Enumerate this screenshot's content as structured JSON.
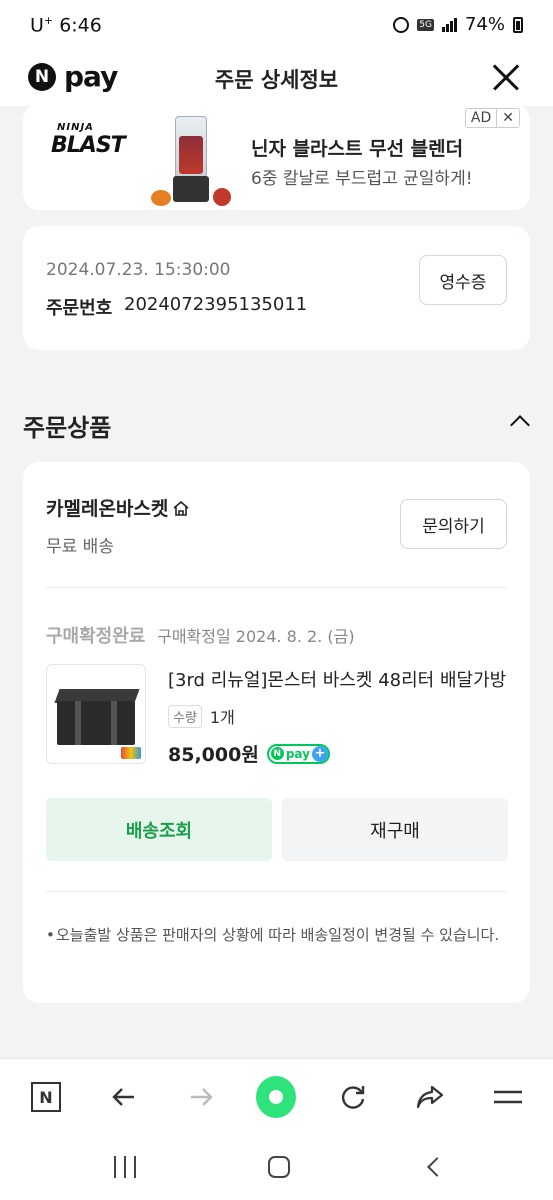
{
  "status_bar": {
    "carrier": "U",
    "carrier_sup": "+",
    "time": "6:46",
    "network": "5G",
    "battery": "74%"
  },
  "header": {
    "logo_letter": "N",
    "logo_text": "pay",
    "title": "주문 상세정보"
  },
  "ad": {
    "brand_small": "NINJA",
    "brand_big": "BLAST",
    "title": "닌자 블라스트 무선 블렌더",
    "subtitle": "6중 칼날로 부드럽고 균일하게!",
    "badge": "AD",
    "badge_close": "✕"
  },
  "order": {
    "datetime": "2024.07.23. 15:30:00",
    "number_label": "주문번호",
    "number": "2024072395135011",
    "receipt_label": "영수증"
  },
  "section": {
    "title": "주문상품"
  },
  "product_card": {
    "seller": "카멜레온바스켓",
    "shipping": "무료 배송",
    "inquiry_label": "문의하기",
    "status": "구매확정완료",
    "status_date": "구매확정일 2024. 8. 2. (금)",
    "product_title": "[3rd 리뉴얼]몬스터 바스켓 48리터 배달가방",
    "qty_tag": "수량",
    "qty": "1개",
    "price": "85,000원",
    "npay_badge": "pay",
    "npay_n": "N",
    "npay_plus": "+",
    "track_label": "배송조회",
    "rebuy_label": "재구매",
    "notice": "오늘출발 상품은 판매자의 상황에 따라 배송일정이 변경될 수 있습니다."
  },
  "browser_bar": {
    "n_label": "N"
  },
  "colors": {
    "accent_green": "#03c75a",
    "track_text": "#1a9e4a",
    "track_bg": "#e6f6ec"
  }
}
